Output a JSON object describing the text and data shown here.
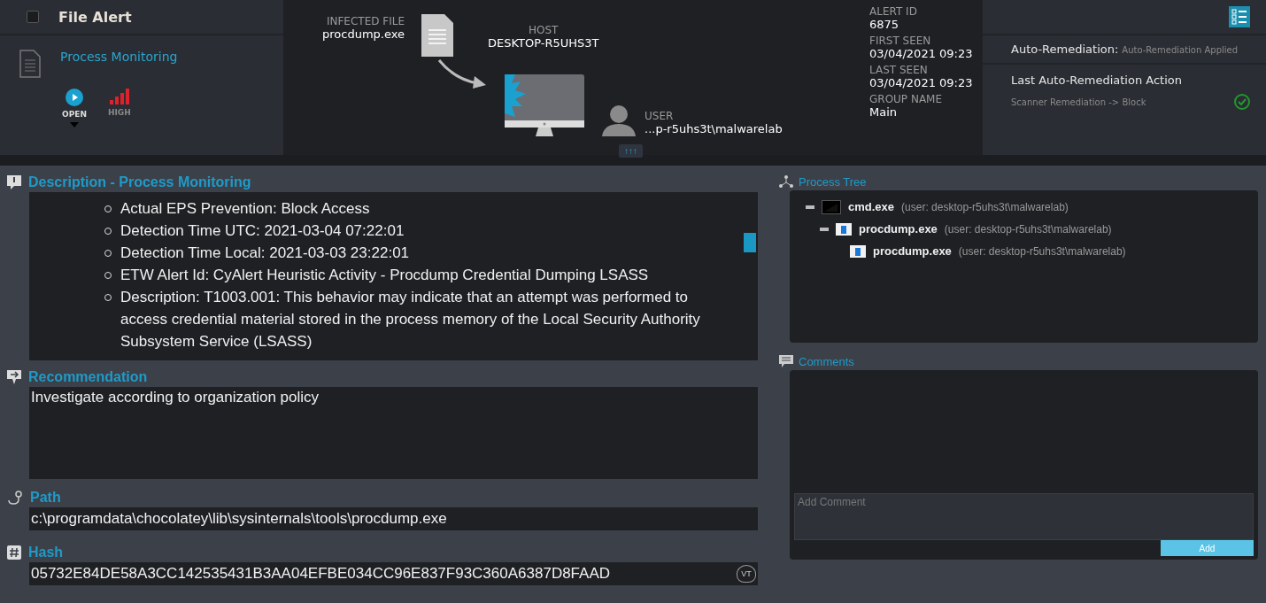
{
  "header": {
    "checked": false,
    "title": "File Alert",
    "type": "Process Monitoring",
    "status": "OPEN",
    "severity": "HIGH"
  },
  "diagram": {
    "file_label": "INFECTED FILE",
    "file": "procdump.exe",
    "host_label": "HOST",
    "host": "DESKTOP-R5UHS3T",
    "user_label": "USER",
    "user": "...p-r5uhs3t\\malwarelab",
    "expand": "↑↑↑"
  },
  "alert_info": [
    {
      "label": "ALERT ID",
      "value": "6875"
    },
    {
      "label": "FIRST SEEN",
      "value": "03/04/2021 09:23"
    },
    {
      "label": "LAST SEEN",
      "value": "03/04/2021 09:23"
    },
    {
      "label": "GROUP NAME",
      "value": "Main"
    }
  ],
  "remediation": {
    "label": "Auto-Remediation:",
    "status": "Auto-Remediation Applied",
    "last_title": "Last Auto-Remediation Action",
    "last_action": "Scanner Remediation -> Block"
  },
  "description": {
    "title": "Description - Process Monitoring",
    "items": [
      "Actual EPS Prevention: Block Access",
      "Detection Time UTC: 2021-03-04 07:22:01",
      "Detection Time Local: 2021-03-03 23:22:01",
      "ETW Alert Id: CyAlert Heuristic Activity - Procdump Credential Dumping LSASS",
      "Description: T1003.001: This behavior may indicate that an attempt was performed to access credential material stored in the process memory of the Local Security Authority Subsystem Service (LSASS)"
    ]
  },
  "recommendation": {
    "title": "Recommendation",
    "text": "Investigate according to organization policy"
  },
  "path": {
    "title": "Path",
    "text": "c:\\programdata\\chocolatey\\lib\\sysinternals\\tools\\procdump.exe"
  },
  "hash": {
    "title": "Hash",
    "text": "05732E84DE58A3CC142535431B3AA04EFBE034CC96E837F93C360A6387D8FAAD",
    "badge": "VT"
  },
  "process_tree": {
    "title": "Process Tree",
    "nodes": [
      {
        "name": "cmd.exe",
        "user": "(user: desktop-r5uhs3t\\malwarelab)",
        "kind": "console",
        "expanded": true,
        "children": [
          {
            "name": "procdump.exe",
            "user": "(user: desktop-r5uhs3t\\malwarelab)",
            "kind": "app",
            "expanded": true,
            "children": [
              {
                "name": "procdump.exe",
                "user": "(user: desktop-r5uhs3t\\malwarelab)",
                "kind": "app"
              }
            ]
          }
        ]
      }
    ]
  },
  "comments": {
    "title": "Comments",
    "placeholder": "Add Comment",
    "button": "Add"
  }
}
